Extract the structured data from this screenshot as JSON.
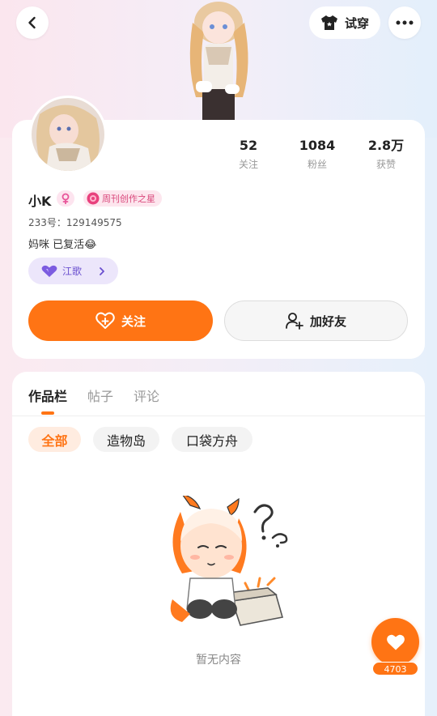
{
  "header": {
    "tryon_label": "试穿",
    "icons": {
      "back": "chevron-left-icon",
      "tryon": "tshirt-icon",
      "more": "more-dots-icon"
    }
  },
  "profile": {
    "username": "小K",
    "gender_icon": "female-icon",
    "title_badge": "周刊创作之星",
    "uid": "233号：129149575",
    "bio": "妈咪 已复活😂",
    "fan_badge": "江歌",
    "stats": [
      {
        "value": "52",
        "label": "关注"
      },
      {
        "value": "1084",
        "label": "粉丝"
      },
      {
        "value": "2.8万",
        "label": "获赞"
      }
    ],
    "follow_label": "关注",
    "add_friend_label": "加好友"
  },
  "tabs": [
    {
      "label": "作品栏",
      "active": true
    },
    {
      "label": "帖子",
      "active": false
    },
    {
      "label": "评论",
      "active": false
    }
  ],
  "filters": [
    {
      "label": "全部",
      "active": true
    },
    {
      "label": "造物岛",
      "active": false
    },
    {
      "label": "口袋方舟",
      "active": false
    }
  ],
  "empty": {
    "text": "暂无内容"
  },
  "like_fab": {
    "count": "4703"
  },
  "colors": {
    "accent": "#ff7414",
    "pink": "#d9467a",
    "purple": "#6a4fcf"
  }
}
